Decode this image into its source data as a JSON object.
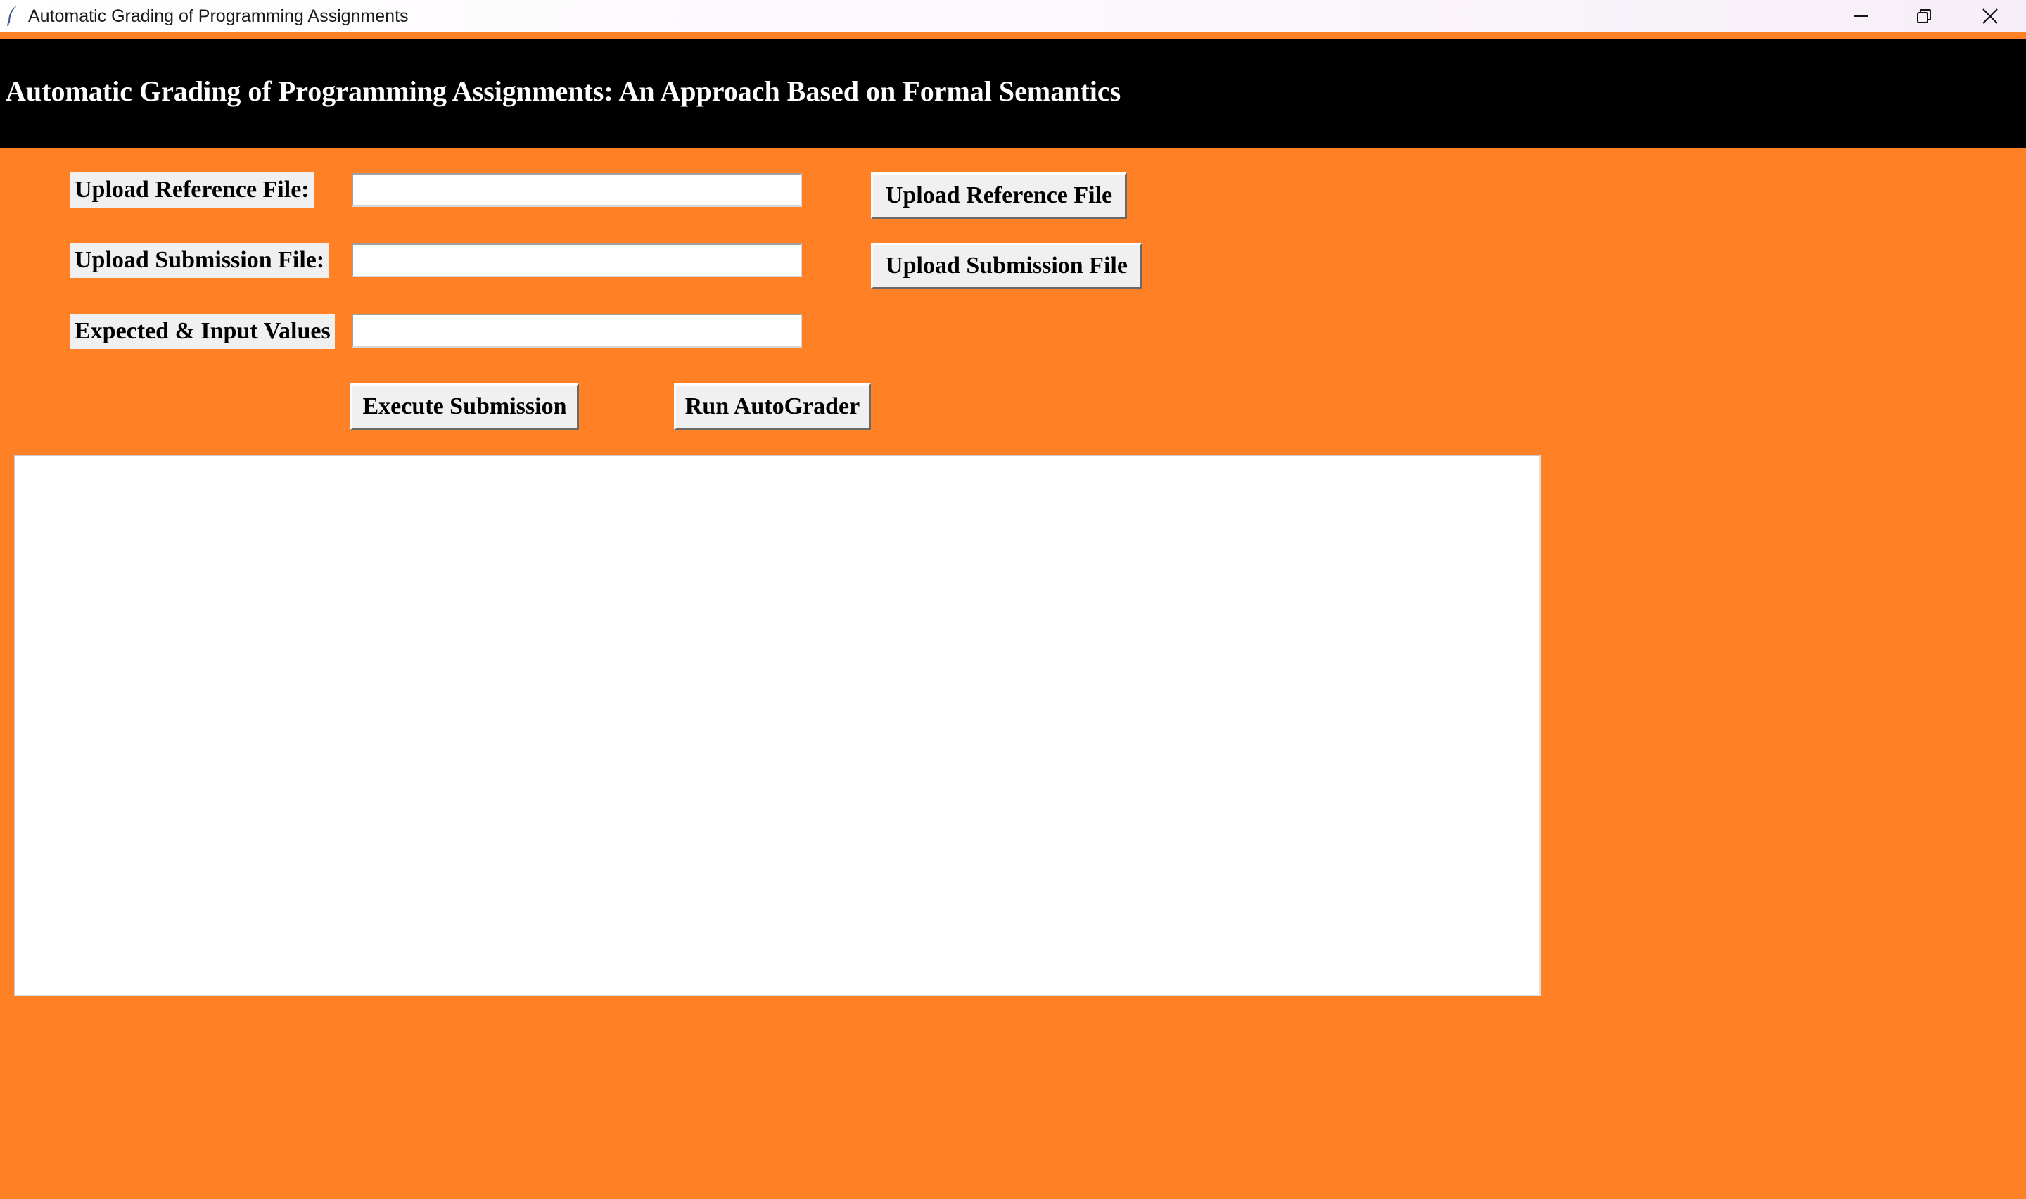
{
  "window": {
    "title": "Automatic Grading of Programming Assignments",
    "icon": "feather-icon",
    "controls": [
      "minimize-icon",
      "restore-icon",
      "close-icon"
    ]
  },
  "header": {
    "title": "Automatic Grading of Programming Assignments: An Approach Based on Formal Semantics"
  },
  "form": {
    "reference_label": "Upload Reference File:",
    "reference_value": "",
    "submission_label": "Upload Submission File:",
    "submission_value": "",
    "values_label": "Expected & Input Values",
    "values_value": ""
  },
  "buttons": {
    "upload_reference": "Upload Reference File",
    "upload_submission": "Upload Submission File",
    "execute": "Execute Submission",
    "run_autograder": "Run AutoGrader"
  },
  "output": {
    "text": ""
  },
  "colors": {
    "background": "#FF8025",
    "header": "#000000",
    "header_text": "#FFFFFF",
    "widget": "#F0F0F0"
  }
}
